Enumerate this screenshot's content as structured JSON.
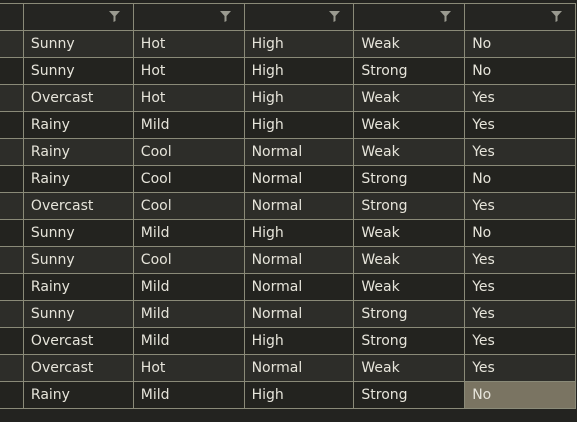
{
  "columns": [
    {
      "label": ""
    },
    {
      "label": ""
    },
    {
      "label": ""
    },
    {
      "label": ""
    },
    {
      "label": ""
    }
  ],
  "rows": [
    [
      "Sunny",
      "Hot",
      "High",
      "Weak",
      "No"
    ],
    [
      "Sunny",
      "Hot",
      "High",
      "Strong",
      "No"
    ],
    [
      "Overcast",
      "Hot",
      "High",
      "Weak",
      "Yes"
    ],
    [
      "Rainy",
      "Mild",
      "High",
      "Weak",
      "Yes"
    ],
    [
      "Rainy",
      "Cool",
      "Normal",
      "Weak",
      "Yes"
    ],
    [
      "Rainy",
      "Cool",
      "Normal",
      "Strong",
      "No"
    ],
    [
      "Overcast",
      "Cool",
      "Normal",
      "Strong",
      "Yes"
    ],
    [
      "Sunny",
      "Mild",
      "High",
      "Weak",
      "No"
    ],
    [
      "Sunny",
      "Cool",
      "Normal",
      "Weak",
      "Yes"
    ],
    [
      "Rainy",
      "Mild",
      "Normal",
      "Weak",
      "Yes"
    ],
    [
      "Sunny",
      "Mild",
      "Normal",
      "Strong",
      "Yes"
    ],
    [
      "Overcast",
      "Mild",
      "High",
      "Strong",
      "Yes"
    ],
    [
      "Overcast",
      "Hot",
      "Normal",
      "Weak",
      "Yes"
    ],
    [
      "Rainy",
      "Mild",
      "High",
      "Strong",
      "No"
    ]
  ],
  "selected_cell": {
    "row": 13,
    "col": 4
  },
  "icons": {
    "filter": "filter-icon"
  },
  "colors": {
    "background": "#232320",
    "row_alt": "#2d2d29",
    "grid_line": "#8a8a78",
    "text": "#e6e4da",
    "selection": "#7a7462",
    "icon": "#9a9a90"
  }
}
